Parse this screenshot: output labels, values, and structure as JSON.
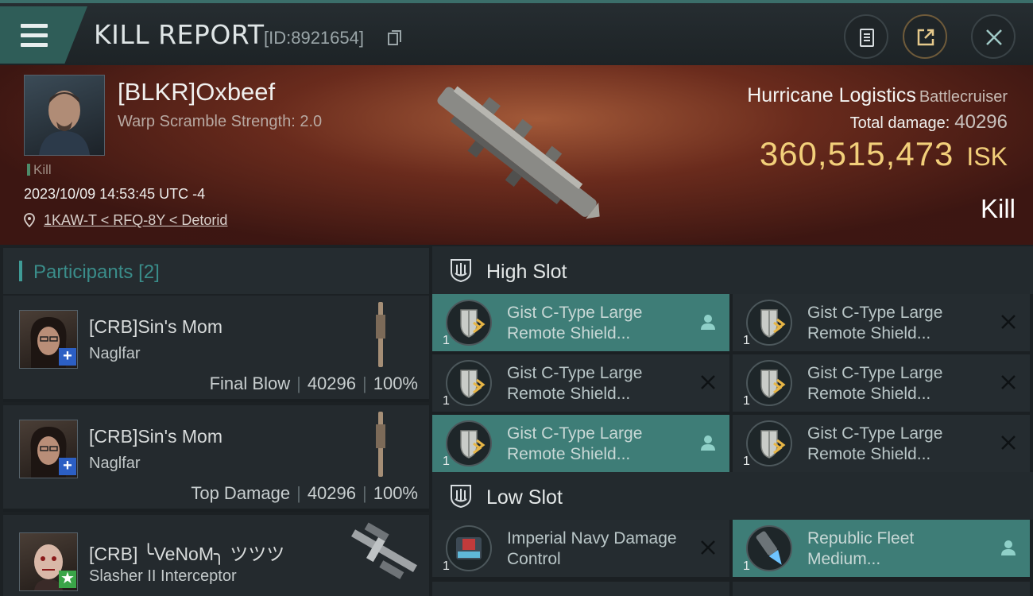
{
  "header": {
    "title": "KILL REPORT",
    "report_id": "[ID:8921654]"
  },
  "victim": {
    "name": "[BLKR]Oxbeef",
    "subtitle": "Warp Scramble Strength: 2.0",
    "tag": "Kill",
    "datetime": "2023/10/09 14:53:45 UTC -4",
    "location": "1KAW-T < RFQ-8Y < Detorid",
    "ship": "Hurricane Logistics",
    "ship_class": "Battlecruiser",
    "total_damage_label": "Total damage:",
    "total_damage": "40296",
    "value": "360,515,473",
    "value_unit": "ISK",
    "result": "Kill"
  },
  "participants": {
    "header": "Participants",
    "count": "[2]",
    "items": [
      {
        "name": "[CRB]Sin's Mom",
        "ship": "Naglfar",
        "role": "Final Blow",
        "damage": "40296",
        "percent": "100%",
        "badge": "+",
        "badge_color": "#2c5fc4"
      },
      {
        "name": "[CRB]Sin's Mom",
        "ship": "Naglfar",
        "role": "Top Damage",
        "damage": "40296",
        "percent": "100%",
        "badge": "+",
        "badge_color": "#2c5fc4"
      },
      {
        "name": "[CRB] ╰VeNoM╮ ツツツ",
        "ship": "Slasher II Interceptor",
        "badge": "★",
        "badge_color": "#3aa548"
      }
    ]
  },
  "slots": {
    "high": {
      "label": "High Slot",
      "modules": [
        {
          "name": "Gist C-Type Large Remote Shield...",
          "qty": "1",
          "state": "person",
          "active": true
        },
        {
          "name": "Gist C-Type Large Remote Shield...",
          "qty": "1",
          "state": "x",
          "active": false
        },
        {
          "name": "Gist C-Type Large Remote Shield...",
          "qty": "1",
          "state": "x",
          "active": false
        },
        {
          "name": "Gist C-Type Large Remote Shield...",
          "qty": "1",
          "state": "x",
          "active": false
        },
        {
          "name": "Gist C-Type Large Remote Shield...",
          "qty": "1",
          "state": "person",
          "active": true
        },
        {
          "name": "Gist C-Type Large Remote Shield...",
          "qty": "1",
          "state": "x",
          "active": false
        }
      ]
    },
    "low": {
      "label": "Low Slot",
      "modules": [
        {
          "name": "Imperial Navy Damage Control",
          "qty": "1",
          "state": "x",
          "active": false
        },
        {
          "name": "Republic Fleet Medium...",
          "qty": "1",
          "state": "person",
          "active": true
        }
      ]
    }
  },
  "colors": {
    "accent": "#3e7d77",
    "isk": "#f2cf7a",
    "participants_header": "#3a8d8a"
  }
}
